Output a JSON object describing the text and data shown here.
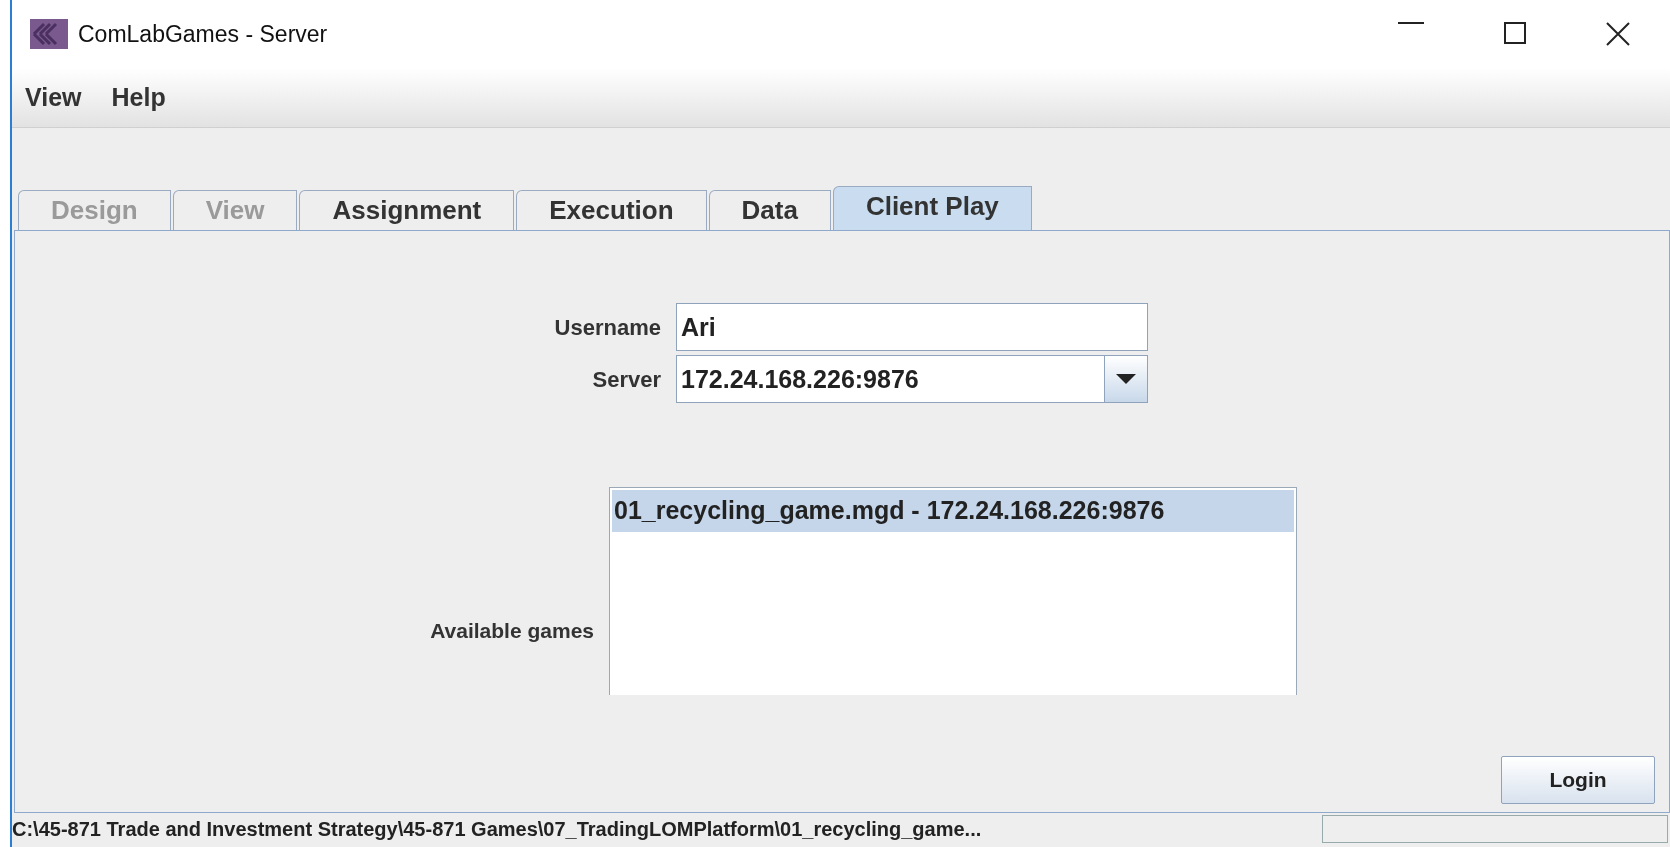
{
  "window": {
    "title": "ComLabGames - Server"
  },
  "menu": [
    {
      "label": "View"
    },
    {
      "label": "Help"
    }
  ],
  "tabs": [
    {
      "label": "Design",
      "selected": false,
      "disabled": true
    },
    {
      "label": "View",
      "selected": false,
      "disabled": true
    },
    {
      "label": "Assignment",
      "selected": false,
      "disabled": false
    },
    {
      "label": "Execution",
      "selected": false,
      "disabled": false
    },
    {
      "label": "Data",
      "selected": false,
      "disabled": false
    },
    {
      "label": "Client Play",
      "selected": true,
      "disabled": false
    }
  ],
  "form": {
    "username": {
      "label": "Username",
      "value": "Ari"
    },
    "server": {
      "label": "Server",
      "value": "172.24.168.226:9876"
    }
  },
  "games": {
    "label": "Available games",
    "items": [
      {
        "label": "01_recycling_game.mgd - 172.24.168.226:9876",
        "selected": true
      }
    ]
  },
  "login_button": "Login",
  "status_bar": {
    "path": "C:\\45-871 Trade and Investment Strategy\\45-871 Games\\07_TradingLOMPlatform\\01_recycling_game..."
  }
}
